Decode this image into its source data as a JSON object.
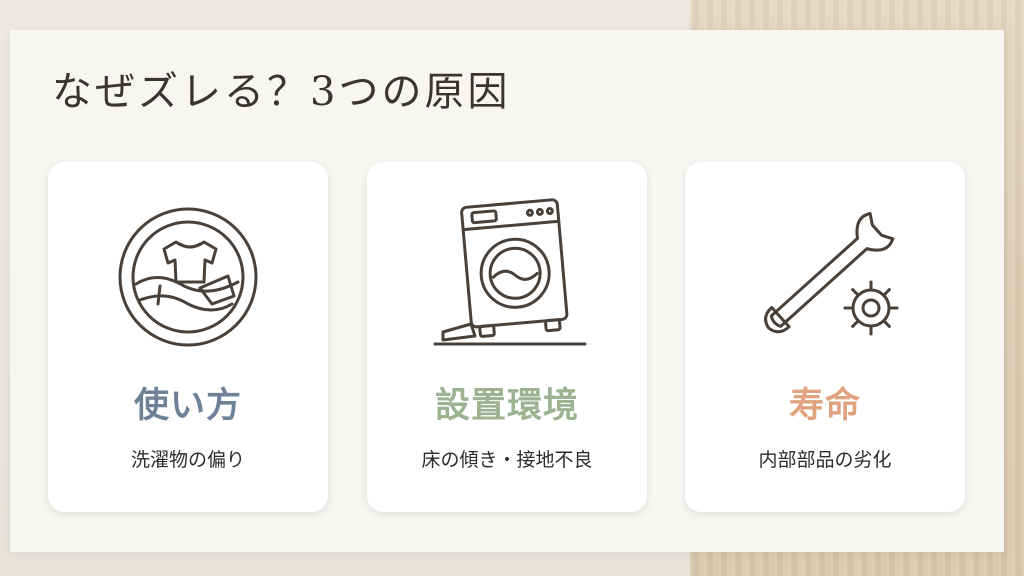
{
  "title": "なぜズレる？3つの原因",
  "colors": {
    "title": "#3a3430",
    "line_icon": "#4a403a",
    "description": "#2f2b28"
  },
  "cards": [
    {
      "title": "使い方",
      "description": "洗濯物の偏り",
      "title_color": "#6f8196",
      "icon": "laundry-drum-icon"
    },
    {
      "title": "設置環境",
      "description": "床の傾き・接地不良",
      "title_color": "#9bb391",
      "icon": "tilted-washing-machine-icon"
    },
    {
      "title": "寿命",
      "description": "内部部品の劣化",
      "title_color": "#e0a380",
      "icon": "wrench-gear-icon"
    }
  ]
}
